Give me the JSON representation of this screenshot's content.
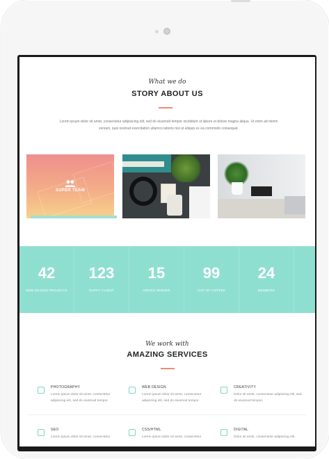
{
  "story": {
    "script": "What we do",
    "title": "STORY ABOUT US",
    "description": "Lorem ipsum dolor sit amet, consectetur adipisicing elit, sed do eiusmod tempor incididunt ut labore et dolore magna aliqua. Ut enim ad minim veniam, quis nostrud exercitation ullamco laboris nisi ut aliquip ex ea commodo consequat."
  },
  "gallery": {
    "team_label": "SUPER TEAM",
    "team_icon": "users-icon"
  },
  "stats": [
    {
      "value": "42",
      "label": "WEB DESIGN PROJECTS"
    },
    {
      "value": "123",
      "label": "HAPPY CLIENT"
    },
    {
      "value": "15",
      "label": "AWARD WINNER"
    },
    {
      "value": "99",
      "label": "CUP OF COFFEE"
    },
    {
      "value": "24",
      "label": "MEMBERS"
    }
  ],
  "services": {
    "script": "We work with",
    "title": "AMAZING SERVICES",
    "items": [
      {
        "icon": "photography-icon",
        "title": "PHOTOGRAPHY",
        "desc": "Lorem ipsum dolor sit amet, consectetur adipiscing elit, sed do eiusmod tempor."
      },
      {
        "icon": "web-design-icon",
        "title": "WEB DESIGN",
        "desc": "Lorem ipsum dolor sit amet, consectetur adipiscing elit, sed do eiusmod tempor."
      },
      {
        "icon": "creativity-icon",
        "title": "CREATIVITY",
        "desc": "Dolor sit amet, consectetur adipiscing elit, sed do eiusmod tempor."
      },
      {
        "icon": "seo-icon",
        "title": "SEO",
        "desc": "Lorem ipsum dolor sit amet, consectetur"
      },
      {
        "icon": "css-html-icon",
        "title": "CSS/HTML",
        "desc": "Lorem ipsum dolor sit amet, consectetur"
      },
      {
        "icon": "digital-icon",
        "title": "DIGITAL",
        "desc": "Dolor sit amet, consectetur adipiscing elit,"
      }
    ]
  },
  "colors": {
    "accent": "#8fdfd1",
    "accent_line": "#f08b6f"
  }
}
